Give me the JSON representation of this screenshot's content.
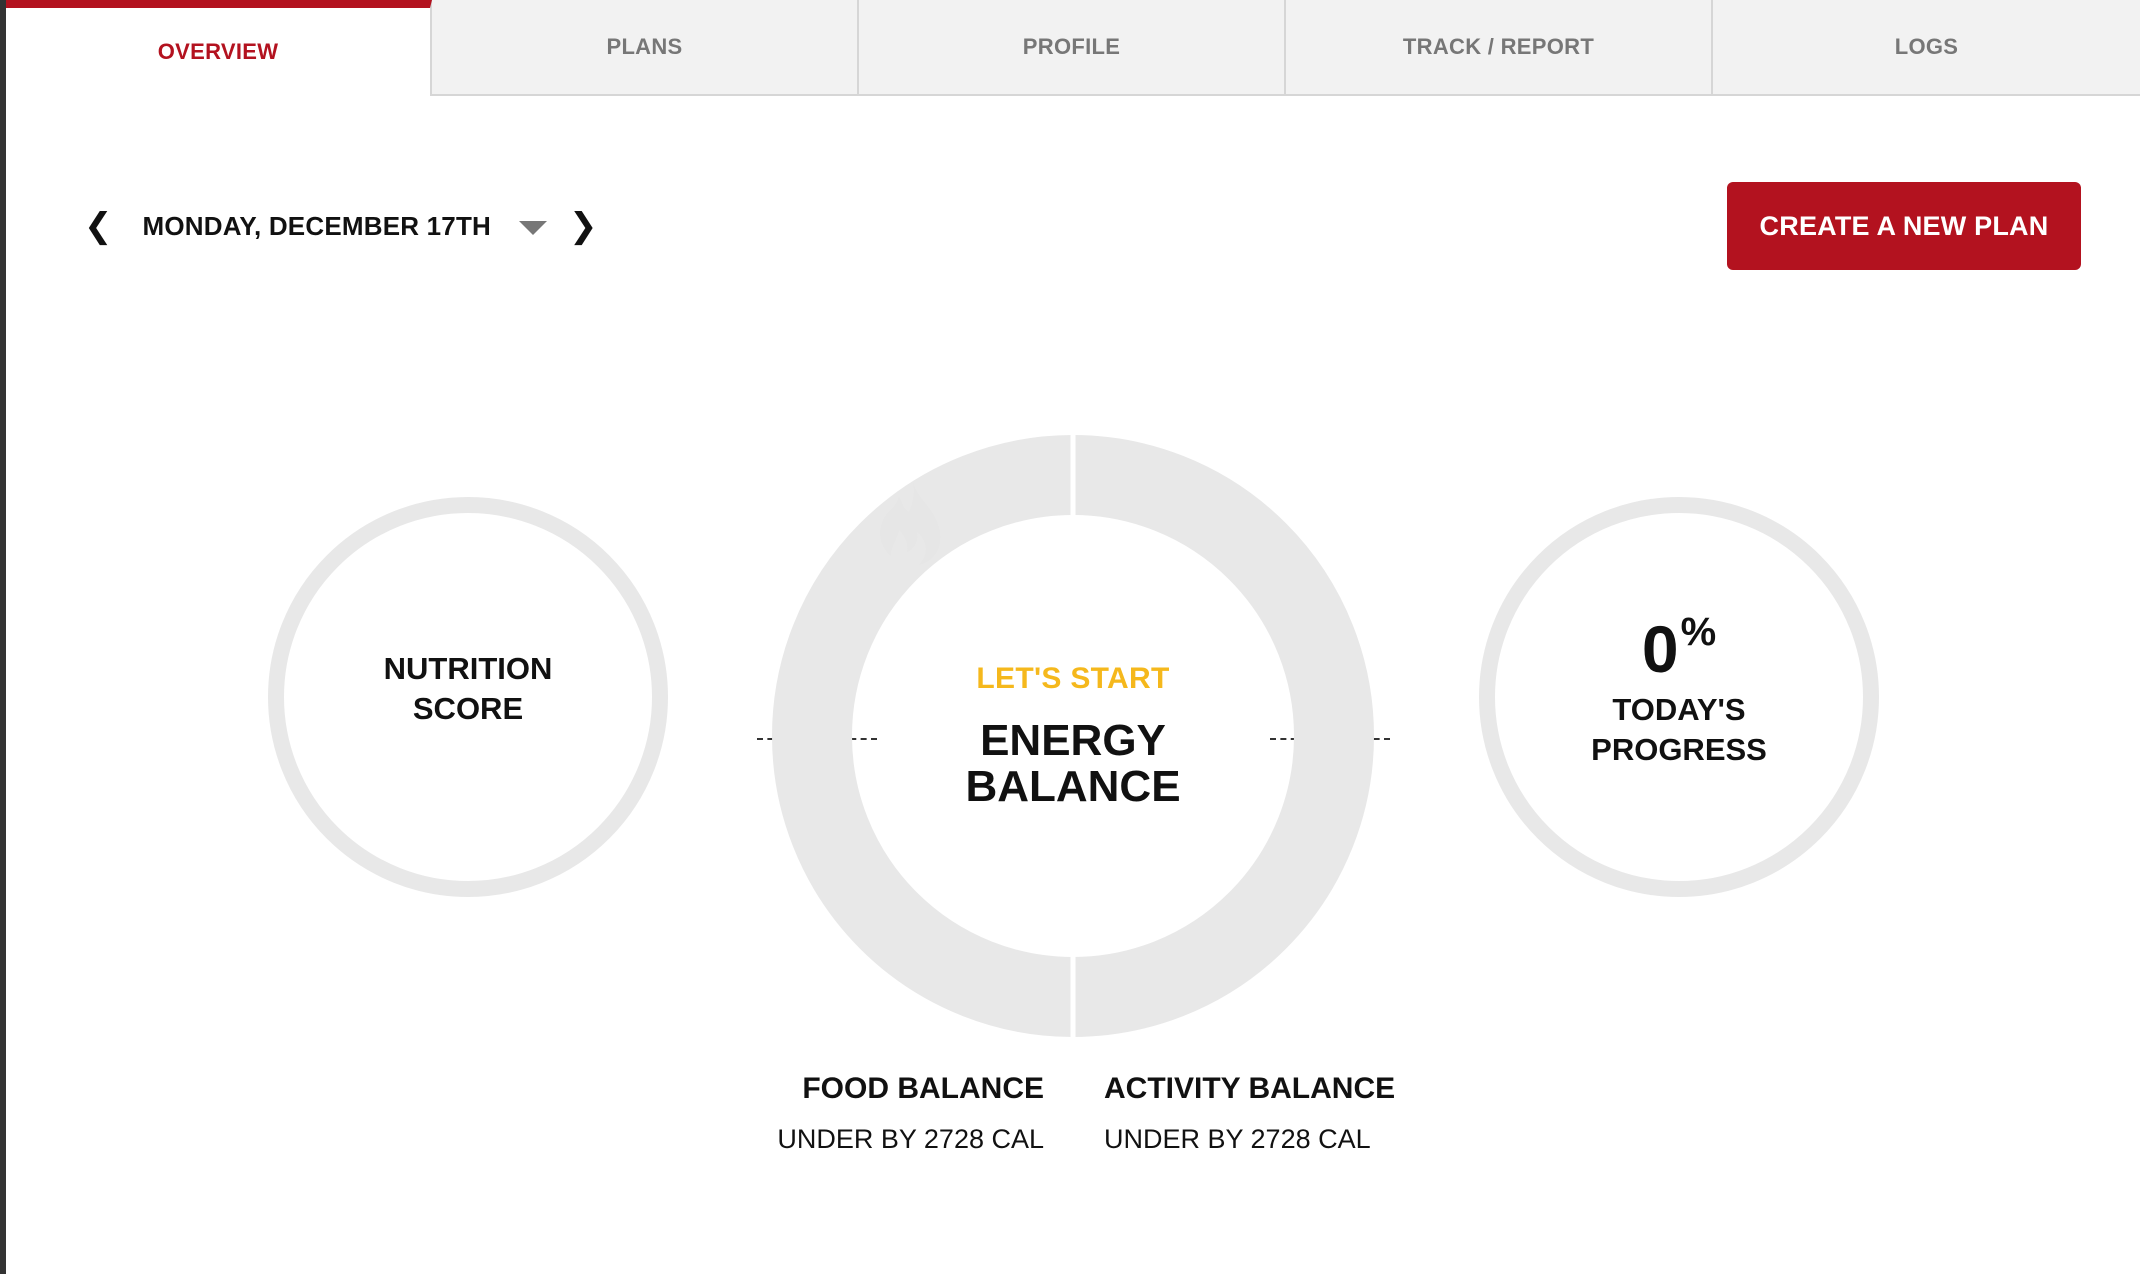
{
  "tabs": [
    {
      "label": "OVERVIEW",
      "active": true
    },
    {
      "label": "PLANS",
      "active": false
    },
    {
      "label": "PROFILE",
      "active": false
    },
    {
      "label": "TRACK / REPORT",
      "active": false
    },
    {
      "label": "LOGS",
      "active": false
    }
  ],
  "date_nav": {
    "prev_icon": "❮",
    "label": "MONDAY, DECEMBER 17TH",
    "next_icon": "❯"
  },
  "create_button": {
    "label": "CREATE A NEW PLAN"
  },
  "nutrition": {
    "title": "NUTRITION SCORE"
  },
  "energy": {
    "subtitle": "LET'S START",
    "title": "ENERGY BALANCE"
  },
  "progress": {
    "value": "0",
    "unit": "%",
    "title": "TODAY'S PROGRESS"
  },
  "food_balance": {
    "title": "FOOD BALANCE",
    "detail": "UNDER BY 2728 CAL"
  },
  "activity_balance": {
    "title": "ACTIVITY BALANCE",
    "detail": "UNDER BY 2728 CAL"
  },
  "colors": {
    "brand_red": "#b3121f",
    "accent_yellow": "#f5b81c",
    "ring_gray": "#e8e8e8"
  }
}
